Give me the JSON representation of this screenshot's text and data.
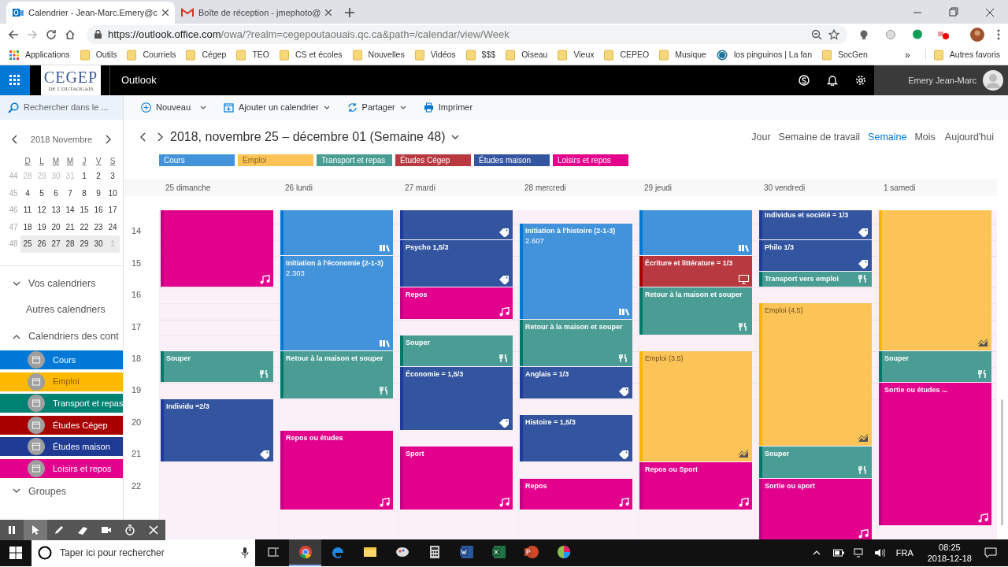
{
  "browser": {
    "tabs": [
      {
        "title": "Calendrier - Jean-Marc.Emery@c",
        "kind": "outlook",
        "selected": true
      },
      {
        "title": "Boîte de réception - jmephoto@",
        "kind": "gmail",
        "selected": false
      }
    ],
    "url": {
      "host": "https://outlook.office.com",
      "path": "/owa/?realm=cegepoutaouais.qc.ca&path=/calendar/view/Week"
    },
    "bookmarks": [
      {
        "label": "Applications",
        "kind": "apps"
      },
      {
        "label": "Outils",
        "kind": "folder"
      },
      {
        "label": "Courriels",
        "kind": "folder"
      },
      {
        "label": "Cégep",
        "kind": "folder"
      },
      {
        "label": "TEO",
        "kind": "folder"
      },
      {
        "label": "CS et écoles",
        "kind": "folder"
      },
      {
        "label": "Nouvelles",
        "kind": "folder"
      },
      {
        "label": "Vidéos",
        "kind": "folder"
      },
      {
        "label": "$$$",
        "kind": "folder"
      },
      {
        "label": "Oiseau",
        "kind": "folder"
      },
      {
        "label": "Vieux",
        "kind": "folder"
      },
      {
        "label": "CEPEO",
        "kind": "folder"
      },
      {
        "label": "Musique",
        "kind": "folder"
      },
      {
        "label": "los pinguinos | La fan",
        "kind": "site"
      },
      {
        "label": "SocGen",
        "kind": "folder"
      }
    ],
    "bookmarks_more": "»",
    "other_bookmarks": "Autres favoris"
  },
  "header": {
    "logo": "CEGEP",
    "logo_subtitle": "DE L'OUTAOUAIS",
    "app": "Outlook",
    "user": "Emery Jean-Marc"
  },
  "search": {
    "placeholder": "Rechercher dans le ..."
  },
  "commands": [
    {
      "label": "Nouveau",
      "kind": "new"
    },
    {
      "label": "Ajouter un calendrier",
      "kind": "add"
    },
    {
      "label": "Partager",
      "kind": "share"
    },
    {
      "label": "Imprimer",
      "kind": "print"
    }
  ],
  "mini_calendar": {
    "title": "2018 Novembre",
    "weekdays": [
      "D",
      "L",
      "M",
      "M",
      "J",
      "V",
      "S"
    ],
    "weeks": [
      {
        "number": "44",
        "days": [
          "28",
          "29",
          "30",
          "31",
          "1",
          "2",
          "3"
        ],
        "outside": [
          true,
          true,
          true,
          true,
          false,
          false,
          false
        ],
        "selected": false
      },
      {
        "number": "45",
        "days": [
          "4",
          "5",
          "6",
          "7",
          "8",
          "9",
          "10"
        ],
        "outside": [
          false,
          false,
          false,
          false,
          false,
          false,
          false
        ],
        "selected": false
      },
      {
        "number": "46",
        "days": [
          "11",
          "12",
          "13",
          "14",
          "15",
          "16",
          "17"
        ],
        "outside": [
          false,
          false,
          false,
          false,
          false,
          false,
          false
        ],
        "selected": false
      },
      {
        "number": "47",
        "days": [
          "18",
          "19",
          "20",
          "21",
          "22",
          "23",
          "24"
        ],
        "outside": [
          false,
          false,
          false,
          false,
          false,
          false,
          false
        ],
        "selected": false
      },
      {
        "number": "48",
        "days": [
          "25",
          "26",
          "27",
          "28",
          "29",
          "30",
          "1"
        ],
        "outside": [
          false,
          false,
          false,
          false,
          false,
          false,
          true
        ],
        "selected": true
      }
    ]
  },
  "sidebar": {
    "sections": [
      {
        "label": "Vos calendriers",
        "expanded": false
      },
      {
        "label": "Autres calendriers"
      },
      {
        "label": "Calendriers des cont",
        "expanded": true
      }
    ],
    "calendars": [
      {
        "label": "Cours",
        "color": "#0078d7"
      },
      {
        "label": "Emploi",
        "color": "#ffb900"
      },
      {
        "label": "Transport et repas",
        "color": "#008272"
      },
      {
        "label": "Études Cégep",
        "color": "#a80000"
      },
      {
        "label": "Études maison",
        "color": "#1f3a93"
      },
      {
        "label": "Loisirs et repos",
        "color": "#e3008c"
      }
    ],
    "groups": {
      "label": "Groupes",
      "expanded": false
    }
  },
  "view": {
    "title": "2018, novembre 25 – décembre 01 (Semaine 48)",
    "modes": [
      {
        "label": "Jour",
        "selected": false
      },
      {
        "label": "Semaine de travail",
        "selected": false
      },
      {
        "label": "Semaine",
        "selected": true
      },
      {
        "label": "Mois",
        "selected": false
      }
    ],
    "today": "Aujourd'hui",
    "legend": [
      {
        "label": "Cours",
        "color": "#4393db"
      },
      {
        "label": "Emploi",
        "color": "#fcc457"
      },
      {
        "label": "Transport et repas",
        "color": "#4a9d94"
      },
      {
        "label": "Études Cégep",
        "color": "#b83a40"
      },
      {
        "label": "Études maison",
        "color": "#33549f"
      },
      {
        "label": "Loisirs et repos",
        "color": "#e3008c"
      }
    ],
    "hours": [
      "14",
      "15",
      "16",
      "17",
      "18",
      "19",
      "20",
      "21",
      "22"
    ],
    "days": [
      {
        "label": "25 dimanche",
        "events": [
          {
            "kind": "loisirs",
            "color": "#e3008c"
          },
          {
            "title": "Souper",
            "kind": "transport",
            "color": "#4a9d94"
          },
          {
            "title": "Individu =2/3",
            "kind": "maison",
            "color": "#33549f"
          }
        ]
      },
      {
        "label": "26 lundi",
        "events": [
          {
            "kind": "cours",
            "color": "#4393db"
          },
          {
            "title": "Initiation à l'économie (2-1-3)",
            "detail": "2.303",
            "kind": "cours",
            "color": "#4393db"
          },
          {
            "title": "Retour à la maison et souper",
            "kind": "transport",
            "color": "#4a9d94"
          },
          {
            "title": "Repos ou études",
            "kind": "loisirs",
            "color": "#e3008c"
          }
        ]
      },
      {
        "label": "27 mardi",
        "events": [
          {
            "kind": "maison",
            "color": "#33549f"
          },
          {
            "title": "Psycho 1,5/3",
            "kind": "maison",
            "color": "#33549f"
          },
          {
            "title": "Repos",
            "kind": "loisirs",
            "color": "#e3008c"
          },
          {
            "title": "Souper",
            "kind": "transport",
            "color": "#4a9d94"
          },
          {
            "title": "Économie = 1,5/3",
            "kind": "maison",
            "color": "#33549f"
          },
          {
            "title": "Sport",
            "kind": "loisirs",
            "color": "#e3008c"
          }
        ]
      },
      {
        "label": "28 mercredi",
        "events": [
          {
            "title": "Initiation à l'histoire (2-1-3)",
            "detail": "2.607",
            "kind": "cours",
            "color": "#4393db"
          },
          {
            "title": "Retour à la maison et souper",
            "kind": "transport",
            "color": "#4a9d94"
          },
          {
            "title": "Anglais = 1/3",
            "kind": "maison",
            "color": "#33549f"
          },
          {
            "title": "Histoire = 1,5/3",
            "kind": "maison",
            "color": "#33549f"
          },
          {
            "title": "Repos",
            "kind": "loisirs",
            "color": "#e3008c"
          }
        ]
      },
      {
        "label": "29 jeudi",
        "events": [
          {
            "kind": "cours",
            "color": "#4393db"
          },
          {
            "title": "Écriture et littérature = 1/3",
            "kind": "cegep",
            "color": "#b83a40"
          },
          {
            "title": "Retour à la maison et souper",
            "kind": "transport",
            "color": "#4a9d94"
          },
          {
            "title": "Emploi (3,5)",
            "kind": "emploi",
            "color": "#fcc457"
          },
          {
            "title": "Repos ou Sport",
            "kind": "loisirs",
            "color": "#e3008c"
          }
        ]
      },
      {
        "label": "30 vendredi",
        "events": [
          {
            "title": "Individus et société = 1/3",
            "kind": "maison",
            "color": "#33549f"
          },
          {
            "title": "Philo 1/3",
            "kind": "maison",
            "color": "#33549f"
          },
          {
            "title": "Transport vers emploi",
            "kind": "transport",
            "color": "#4a9d94"
          },
          {
            "title": "Emploi (4,5)",
            "kind": "emploi",
            "color": "#fcc457"
          },
          {
            "title": "Souper",
            "kind": "transport",
            "color": "#4a9d94"
          },
          {
            "title": "Sortie ou sport",
            "kind": "loisirs",
            "color": "#e3008c"
          }
        ]
      },
      {
        "label": "1 samedi",
        "events": [
          {
            "kind": "emploi",
            "color": "#fcc457"
          },
          {
            "title": "Souper",
            "kind": "transport",
            "color": "#4a9d94"
          },
          {
            "title": "Sortie ou études ...",
            "kind": "loisirs",
            "color": "#e3008c"
          }
        ]
      }
    ]
  },
  "recorder": [
    {
      "kind": "pause",
      "selected": false
    },
    {
      "kind": "cursor",
      "selected": true
    },
    {
      "kind": "pen",
      "selected": false
    },
    {
      "kind": "eraser",
      "selected": false
    },
    {
      "kind": "camera",
      "selected": false
    },
    {
      "kind": "timer",
      "selected": false
    },
    {
      "kind": "close",
      "selected": false
    }
  ],
  "taskbar": {
    "search": {
      "placeholder": "Taper ici pour rechercher"
    },
    "apps": [
      {
        "kind": "taskview",
        "selected": false
      },
      {
        "kind": "chrome",
        "selected": true
      },
      {
        "kind": "edge",
        "selected": false
      },
      {
        "kind": "explorer",
        "selected": false
      },
      {
        "kind": "paint",
        "selected": false
      },
      {
        "kind": "calculator",
        "selected": false
      },
      {
        "kind": "word",
        "selected": false
      },
      {
        "kind": "excel",
        "selected": false
      },
      {
        "kind": "powerpoint",
        "selected": false
      },
      {
        "kind": "palette",
        "selected": false
      }
    ],
    "language": "FRA",
    "time": "08:25",
    "date": "2018-12-18"
  }
}
